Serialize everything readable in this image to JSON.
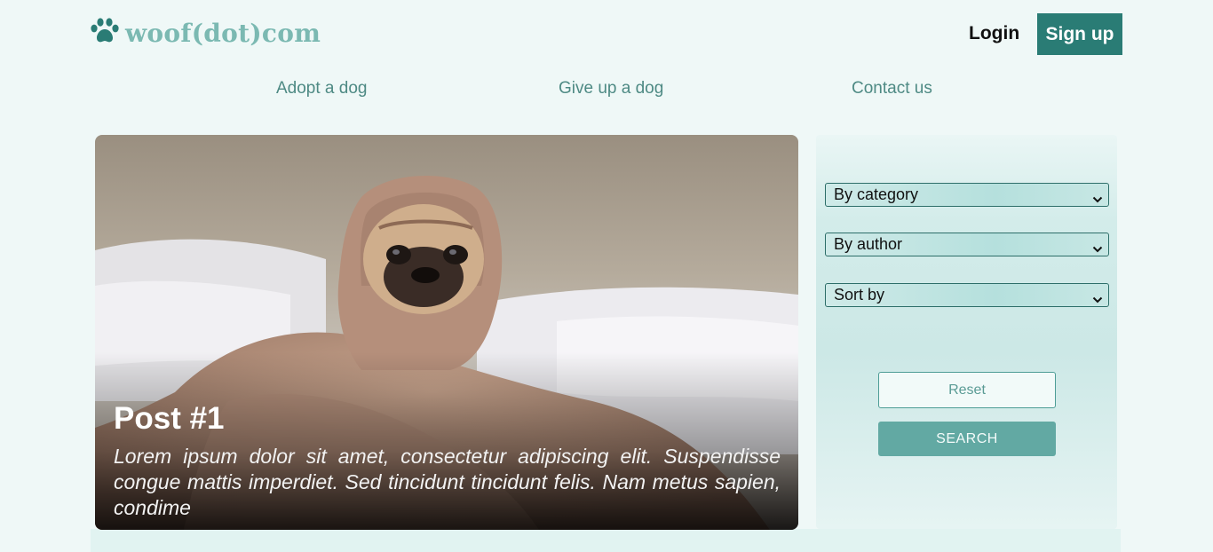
{
  "header": {
    "logo_text": "woof(dot)com",
    "login_label": "Login",
    "signup_label": "Sign up"
  },
  "nav": {
    "items": [
      {
        "label": "Adopt a dog"
      },
      {
        "label": "Give up a dog"
      },
      {
        "label": "Contact us"
      }
    ]
  },
  "post": {
    "title": "Post #1",
    "excerpt": "Lorem ipsum dolor sit amet, consectetur adipiscing elit. Suspendisse congue mattis imperdiet. Sed tincidunt tincidunt felis. Nam metus sapien, condime"
  },
  "filters": {
    "category_selected": "By category",
    "author_selected": "By author",
    "sort_selected": "Sort by",
    "reset_label": "Reset",
    "search_label": "SEARCH"
  },
  "colors": {
    "accent": "#2a7c75",
    "logo": "#7bb9b2",
    "nav_link": "#4e8a84",
    "search_button": "#62a9a3",
    "page_background": "#eff8f7"
  },
  "icons": {
    "logo": "paw-icon",
    "select": "chevron-down-icon"
  }
}
